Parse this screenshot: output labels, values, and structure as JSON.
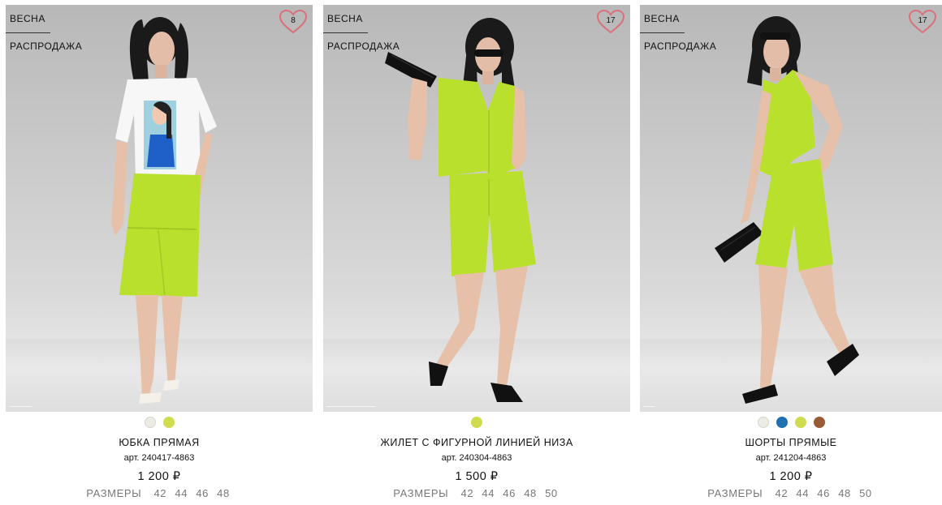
{
  "products": [
    {
      "tag_season": "ВЕСНА",
      "tag_sale": "РАСПРОДАЖА",
      "favorites_count": "8",
      "colors": [
        "#ecebe4",
        "#cfdc4e"
      ],
      "name": "ЮБКА ПРЯМАЯ",
      "sku": "арт. 240417-4863",
      "price": "1 200 ₽",
      "sizes_label": "РАЗМЕРЫ",
      "sizes": [
        "42",
        "44",
        "46",
        "48"
      ]
    },
    {
      "tag_season": "ВЕСНА",
      "tag_sale": "РАСПРОДАЖА",
      "favorites_count": "17",
      "colors": [
        "#cfdc4e"
      ],
      "name": "ЖИЛЕТ С ФИГУРНОЙ ЛИНИЕЙ НИЗА",
      "sku": "арт. 240304-4863",
      "price": "1 500 ₽",
      "sizes_label": "РАЗМЕРЫ",
      "sizes": [
        "42",
        "44",
        "46",
        "48",
        "50"
      ]
    },
    {
      "tag_season": "ВЕСНА",
      "tag_sale": "РАСПРОДАЖА",
      "favorites_count": "17",
      "colors": [
        "#ecebe4",
        "#1f6fb3",
        "#cfdc4e",
        "#9a5a35"
      ],
      "name": "ШОРТЫ ПРЯМЫЕ",
      "sku": "арт. 241204-4863",
      "price": "1 200 ₽",
      "sizes_label": "РАЗМЕРЫ",
      "sizes": [
        "42",
        "44",
        "46",
        "48",
        "50"
      ]
    }
  ],
  "theme": {
    "accent_heart": "#d9707a",
    "garment_lime": "#b9e02c",
    "sizes_text": "#777777"
  }
}
